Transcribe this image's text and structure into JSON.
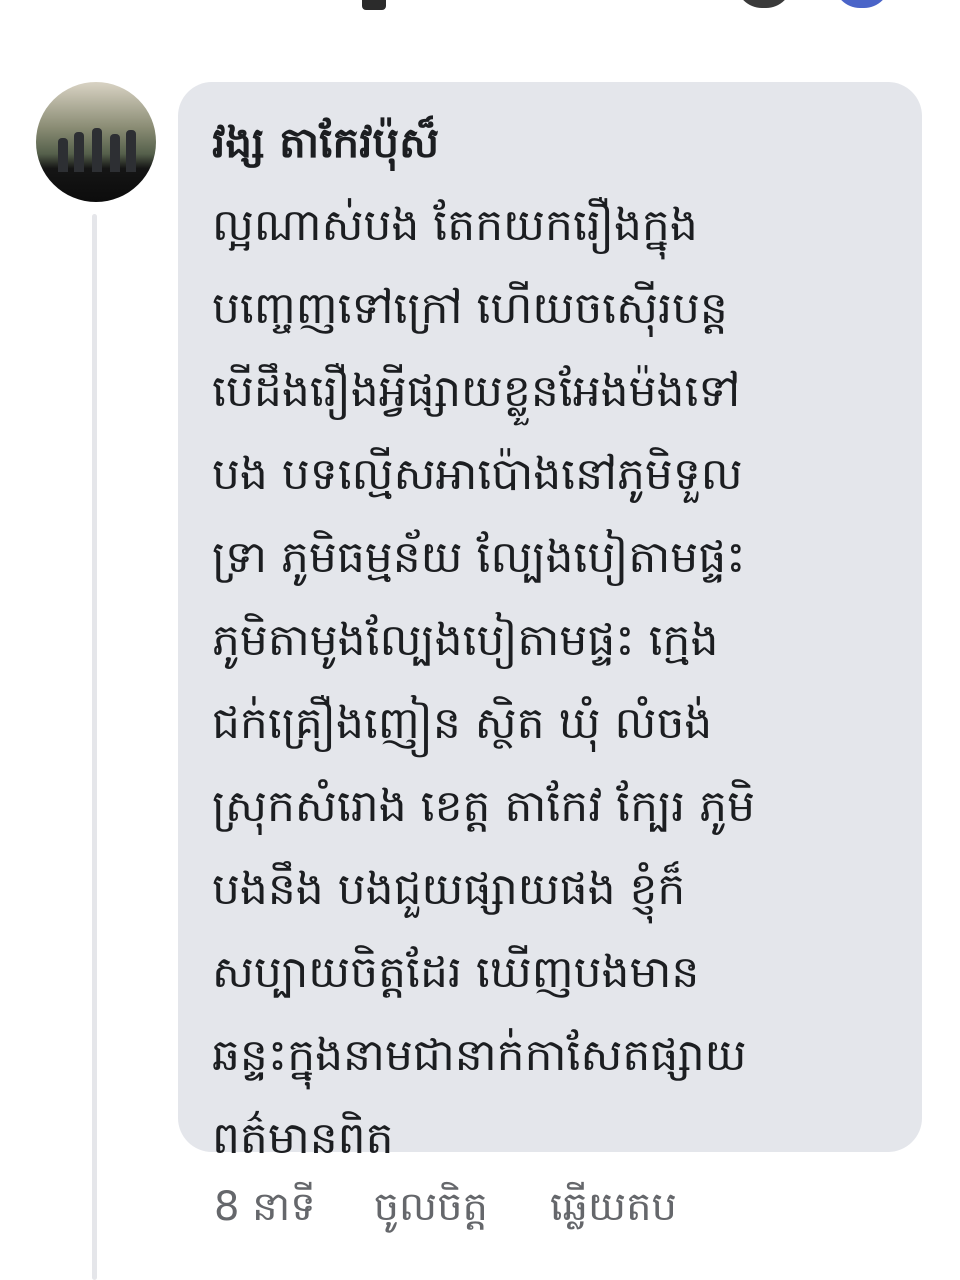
{
  "comment": {
    "author": "វង្ស តាកែវប៉ុស៏",
    "lines": [
      "ល្អណាស់បង តែកយករឿងក្នុង",
      "បញ្ចេញទៅក្រៅ ហើយចស៊ើរបន្ត",
      "បើដឹងរឿងអ្វីផ្សាយខ្លួនអែងម៉ងទៅ",
      "បង បទល្មើសអាប៉ោងនៅភូមិទួល",
      "ទ្រា ភូមិធម្មន័យ ល្បែងបៀតាមផ្ទះ",
      "ភូមិតាមូងល្បែងបៀតាមផ្ទះ ក្មេង",
      "ជក់គ្រឿងញៀន ស្ថិត ឃុំ លំចង់",
      "ស្រុកសំរោង ខេត្ត តាកែវ ក្បែរ ភូមិ",
      "បងនឹង បងជួយផ្សាយផង ខ្ញុំក៏",
      "សប្បាយចិត្តដែរ ឃើញបងមាន",
      "ឆន្ទះក្នុងនាមជានាក់កាសែតផ្សាយ",
      "ពត៌មានពិត"
    ]
  },
  "actions": {
    "time": "8 នាទី",
    "like": "ចូលចិត្ត",
    "reply": "ឆ្លើយតប"
  },
  "icons": {
    "avatar": "profile-photo",
    "top_left": "partial-icon",
    "top_right_1": "partial-reaction-icon",
    "top_right_2": "partial-reaction-icon"
  },
  "colors": {
    "bubble": "#e4e6eb",
    "text": "#1c1e21",
    "meta": "#65676b"
  }
}
